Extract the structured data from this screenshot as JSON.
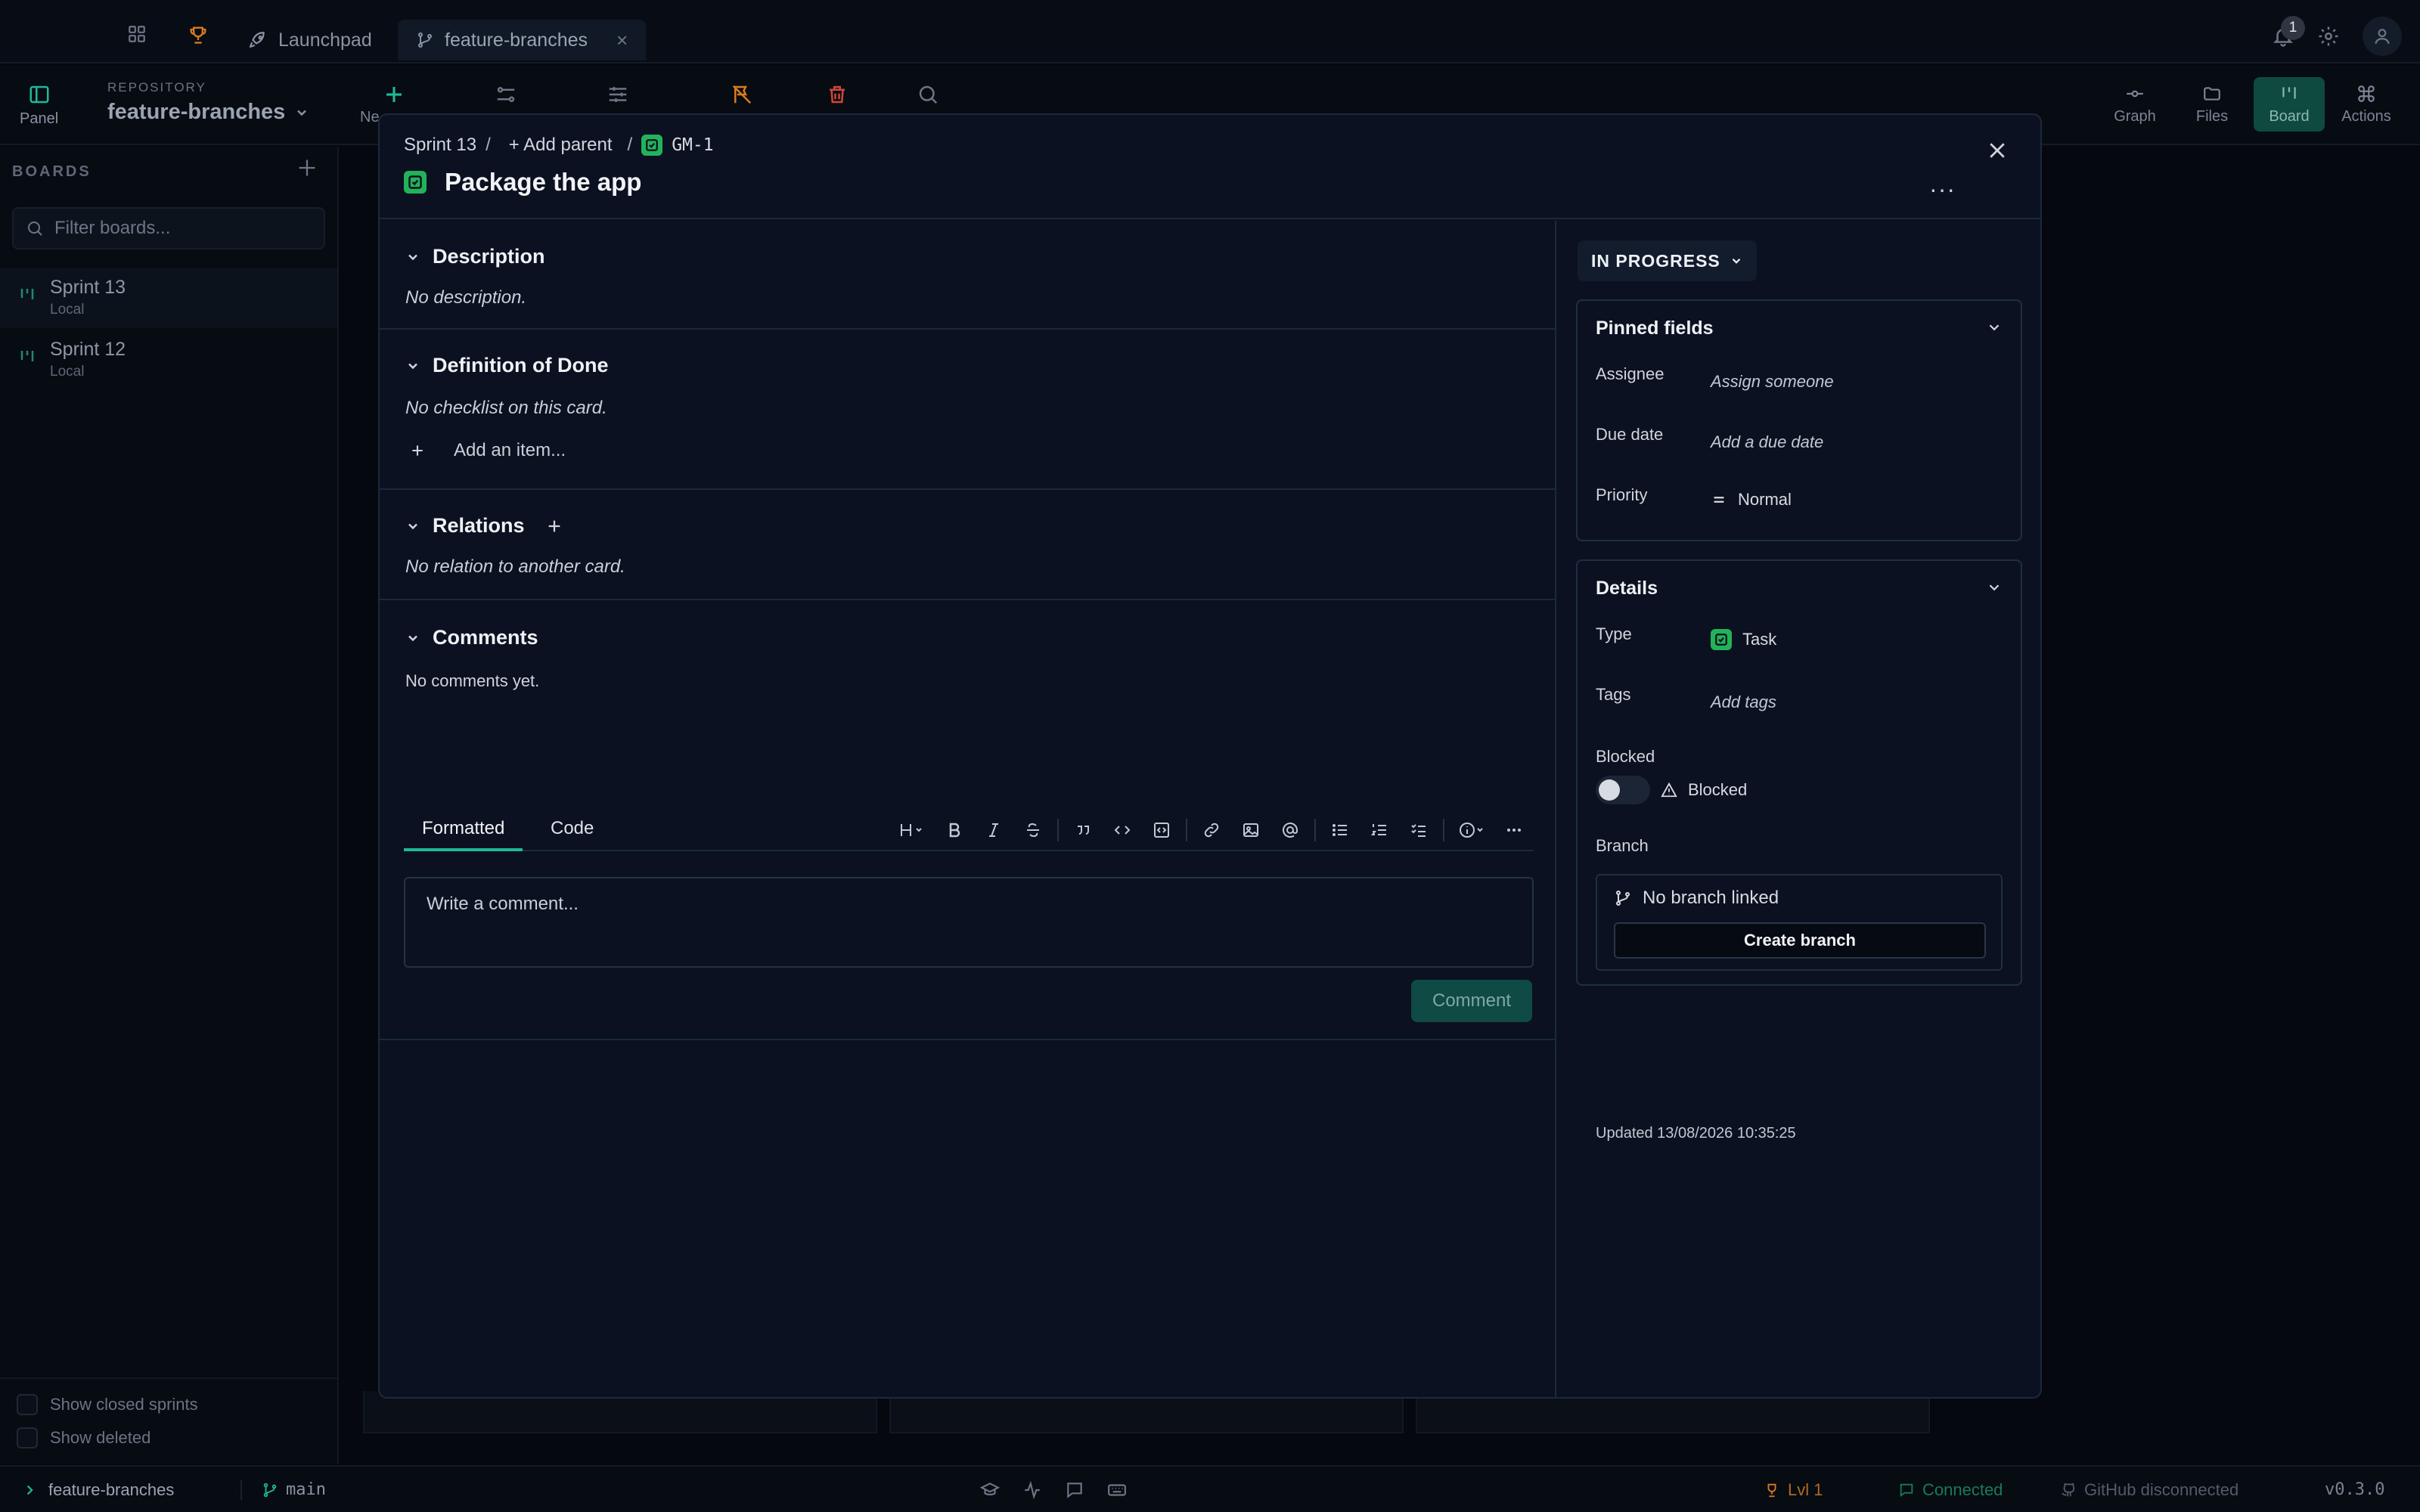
{
  "tabbar": {
    "tabs": [
      {
        "label": "Launchpad"
      },
      {
        "label": "feature-branches"
      }
    ],
    "close_glyph": "×",
    "notification_count": "1"
  },
  "toolbar": {
    "panel_label": "Panel",
    "repo_label": "REPOSITORY",
    "repo_name": "feature-branches",
    "new_label_partial": "Ne",
    "right_nav": [
      {
        "label": "Graph",
        "icon": "graph-icon"
      },
      {
        "label": "Files",
        "icon": "folder-icon"
      },
      {
        "label": "Board",
        "icon": "board-icon",
        "active": true
      },
      {
        "label": "Actions",
        "icon": "command-icon"
      }
    ]
  },
  "sidebar": {
    "heading": "BOARDS",
    "filter_placeholder": "Filter boards...",
    "boards": [
      {
        "title": "Sprint 13",
        "subtitle": "Local"
      },
      {
        "title": "Sprint 12",
        "subtitle": "Local"
      }
    ],
    "show_closed": "Show closed sprints",
    "show_deleted": "Show deleted"
  },
  "statusbar": {
    "repo": "feature-branches",
    "branch": "main",
    "level": "Lvl 1",
    "connection": "Connected",
    "github": "GitHub disconnected",
    "version": "v0.3.0"
  },
  "modal": {
    "breadcrumb": {
      "sprint": "Sprint 13",
      "sep": "/",
      "add_parent": "+ Add parent",
      "key": "GM-1"
    },
    "title": "Package the app",
    "more_glyph": "···",
    "description": {
      "title": "Description",
      "empty": "No description."
    },
    "dod": {
      "title": "Definition of Done",
      "empty": "No checklist on this card.",
      "add": "Add an item..."
    },
    "relations": {
      "title": "Relations",
      "empty": "No relation to another card."
    },
    "comments": {
      "title": "Comments",
      "empty": "No comments yet.",
      "tab_formatted": "Formatted",
      "tab_code": "Code",
      "placeholder": "Write a comment...",
      "submit": "Comment"
    },
    "status": "IN PROGRESS",
    "pinned": {
      "title": "Pinned fields",
      "assignee_label": "Assignee",
      "assignee_value": "Assign someone",
      "due_label": "Due date",
      "due_value": "Add a due date",
      "priority_label": "Priority",
      "priority_value": "Normal"
    },
    "details": {
      "title": "Details",
      "type_label": "Type",
      "type_value": "Task",
      "tags_label": "Tags",
      "tags_value": "Add tags",
      "blocked_label": "Blocked",
      "blocked_toggle": "Blocked",
      "branch_label": "Branch",
      "no_branch": "No branch linked",
      "create_branch": "Create branch"
    },
    "updated": "Updated 13/08/2026 10:35:25"
  },
  "colors": {
    "accent": "#1fb89a",
    "task_green": "#22b35a",
    "danger": "#d0453a",
    "warn": "#d97a1e"
  }
}
